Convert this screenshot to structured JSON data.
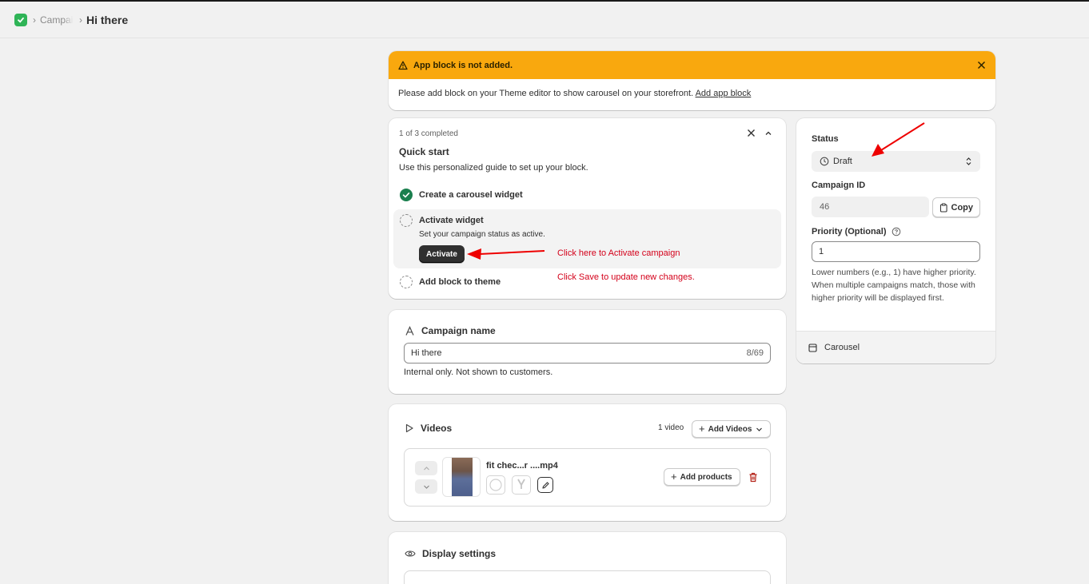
{
  "breadcrumb": {
    "parent": "Campaigns",
    "current": "Hi there"
  },
  "banner": {
    "title": "App block is not added.",
    "message": "Please add block on your Theme editor to show carousel on your storefront.",
    "link": "Add app block"
  },
  "quickstart": {
    "progress": "1 of 3 completed",
    "title": "Quick start",
    "description": "Use this personalized guide to set up your block.",
    "steps": [
      {
        "label": "Create a carousel widget",
        "done": true
      },
      {
        "label": "Activate widget",
        "sub": "Set your campaign status as active.",
        "button": "Activate",
        "done": false
      },
      {
        "label": "Add block to theme",
        "done": false
      }
    ]
  },
  "annotations": {
    "activate_note": "Click here to Activate campaign",
    "save_note": "Click Save to update new changes.",
    "color": "#d4001a"
  },
  "campaign_name": {
    "label": "Campaign name",
    "value": "Hi there",
    "count": "8/69",
    "help": "Internal only. Not shown to customers."
  },
  "videos": {
    "label": "Videos",
    "count": "1 video",
    "add_button": "Add Videos",
    "items": [
      {
        "name": "fit chec...r ....mp4",
        "add_products": "Add products"
      }
    ]
  },
  "display_settings": {
    "label": "Display settings"
  },
  "sidebar": {
    "status_label": "Status",
    "status_value": "Draft",
    "campaign_id_label": "Campaign ID",
    "campaign_id": "46",
    "copy_button": "Copy",
    "priority_label": "Priority (Optional)",
    "priority_value": "1",
    "priority_help": "Lower numbers (e.g., 1) have higher priority. When multiple campaigns match, those with higher priority will be displayed first.",
    "footer_label": "Carousel"
  },
  "colors": {
    "banner": "#f9a80e",
    "success": "#1a7f4e",
    "brand": "#2fb457",
    "danger": "#b42318"
  }
}
